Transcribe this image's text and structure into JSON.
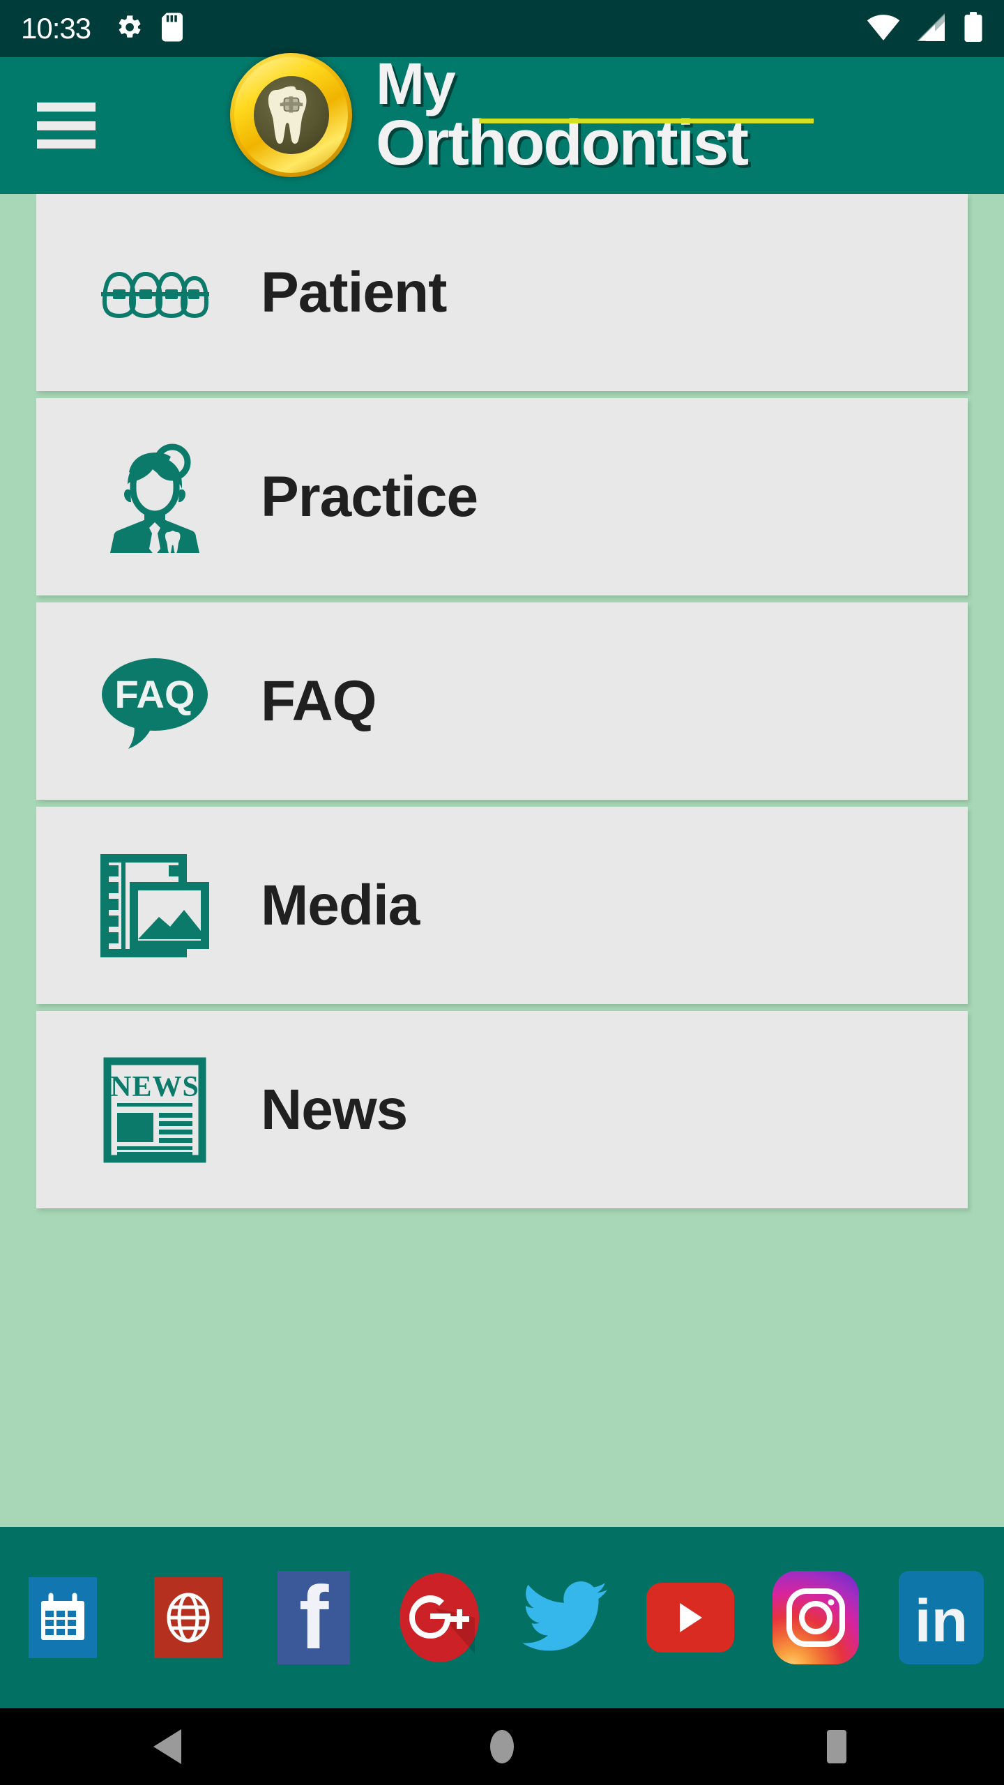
{
  "status_bar": {
    "clock": "10:33",
    "left_icons": [
      "settings-gear-icon",
      "sd-card-icon"
    ],
    "right_icons": [
      "wifi-icon",
      "cellular-signal-icon",
      "battery-icon"
    ],
    "background_color": "#003c3a",
    "text_color": "#ffffff"
  },
  "header": {
    "menu_button": "hamburger-menu-icon",
    "logo": "tooth-with-braces-badge-logo",
    "brand_line_1": "My",
    "brand_line_2": "Orthodontist",
    "background_color": "#027a6b",
    "rule_color": "#d4e022",
    "brand_text_color": "#f2f2f2"
  },
  "menu": {
    "background_color": "#a7d7b6",
    "card_color": "#e8e8e8",
    "icon_color": "#0b7a6a",
    "items": [
      {
        "label": "Patient",
        "icon": "braces-teeth-icon"
      },
      {
        "label": "Practice",
        "icon": "dentist-person-icon"
      },
      {
        "label": "FAQ",
        "icon": "faq-speech-bubble-icon"
      },
      {
        "label": "Media",
        "icon": "film-photo-icon"
      },
      {
        "label": "News",
        "icon": "newspaper-icon"
      }
    ]
  },
  "social_bar": {
    "background_color": "#027063",
    "items": [
      {
        "name": "calendar",
        "icon": "calendar-icon",
        "color": "#1277b0"
      },
      {
        "name": "website",
        "icon": "globe-icon",
        "color": "#b6301f"
      },
      {
        "name": "facebook",
        "icon": "facebook-icon",
        "color": "#3b5998"
      },
      {
        "name": "googleplus",
        "icon": "google-plus-icon",
        "color": "#cc2127"
      },
      {
        "name": "twitter",
        "icon": "twitter-bird-icon",
        "color": "#35b7ec"
      },
      {
        "name": "youtube",
        "icon": "youtube-icon",
        "color": "#d92b21"
      },
      {
        "name": "instagram",
        "icon": "instagram-icon",
        "color": "#d6249f"
      },
      {
        "name": "linkedin",
        "icon": "linkedin-icon",
        "color": "#0e76a8"
      }
    ]
  },
  "nav_bar": {
    "background_color": "#000000",
    "buttons": [
      {
        "name": "back",
        "icon": "back-triangle-icon"
      },
      {
        "name": "home",
        "icon": "home-circle-icon"
      },
      {
        "name": "recents",
        "icon": "recents-square-icon"
      }
    ]
  },
  "newspaper_icon_text": "NEWS",
  "faq_icon_text": "FAQ",
  "google_plus_glyph": "G+",
  "facebook_glyph": "f",
  "linkedin_glyph": "in"
}
